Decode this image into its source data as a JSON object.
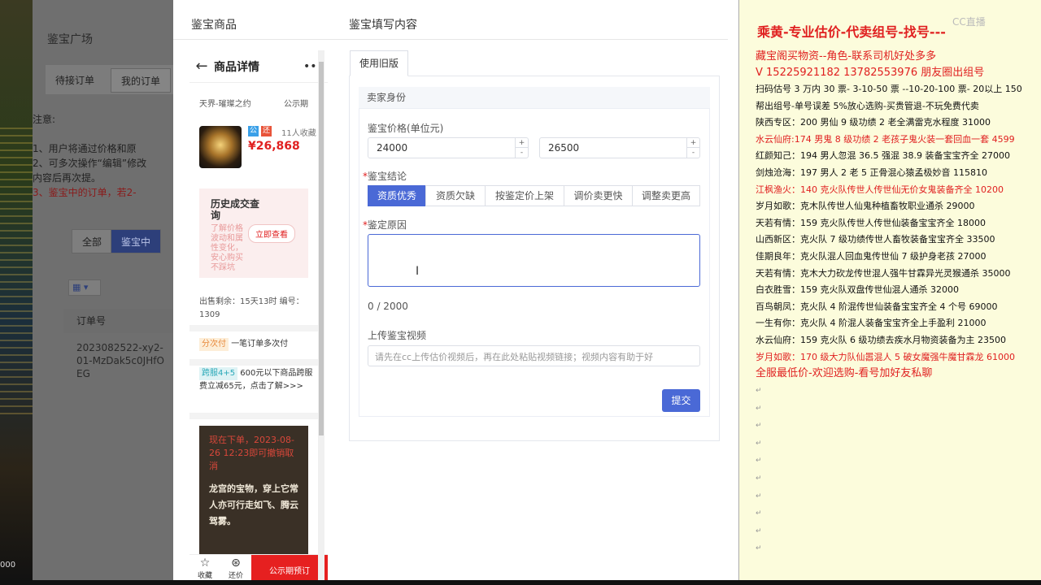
{
  "background": {
    "square_title": "鉴宝广场",
    "tabs": [
      "待接订单",
      "我的订单"
    ],
    "notice_title": "注意:",
    "notice_lines": [
      "1、用户将通过价格和原",
      "2、可多次操作“编辑”修改",
      "内容后再次提。",
      "3、鉴宝中的订单，若2-"
    ],
    "filters": [
      "全部",
      "鉴宝中"
    ],
    "order_header": "订单号",
    "order_value": "2023082522-xy2-01-MzDak5c0JHfOEG",
    "game_bottom": "000"
  },
  "modal": {
    "left_title": "鉴宝商品",
    "right_title": "鉴宝填写内容"
  },
  "phone": {
    "header_title": "商品详情",
    "server": "天界-璀璨之约",
    "period": "公示期",
    "badge1": "公",
    "badge2": "还",
    "favorites": "11人收藏",
    "price": "¥26,868",
    "history_title": "历史成交查询",
    "history_desc": "了解价格波动和属性变化，安心购买不踩坑",
    "history_btn": "立即查看",
    "stats": "出售剩余：15天13时  编号：1309",
    "installment_tag": "分次付",
    "installment_text": "一笔订单多次付",
    "cross_tag": "跨服4+5",
    "cross_text": "600元以下商品跨服费立减65元，点击了解>>>",
    "dark_red": "现在下单，2023-08-26 12:23即可撤销取消",
    "dark_white": "龙宫的宝物，穿上它常人亦可行走如飞、腾云驾雾。",
    "foot_fav": "收藏",
    "foot_bargain": "还价",
    "foot_buy": "公示期预订"
  },
  "form": {
    "tab_label": "使用旧版",
    "section_title": "卖家身份",
    "price_label": "鉴宝价格(单位元)",
    "price_min": "24000",
    "price_max": "26500",
    "conclusion_label": "鉴宝结论",
    "conclusion_options": [
      "资质优秀",
      "资质欠缺",
      "按鉴定价上架",
      "调价卖更快",
      "调整卖更高"
    ],
    "reason_label": "鉴定原因",
    "counter": "0 / 2000",
    "video_label": "上传鉴宝视频",
    "video_placeholder": "请先在cc上传估价视频后，再在此处粘贴视频链接；视频内容有助于好",
    "submit_label": "提交"
  },
  "notepad": {
    "title": "乘黄-专业估价-代卖组号-找号---",
    "watermark": "CC直播",
    "lines": [
      {
        "text": "藏宝阁买物资--角色-联系司机好处多多",
        "color": "red",
        "size": "big"
      },
      {
        "text": "V 15225921182   13782553976 朋友圈出组号",
        "color": "red",
        "size": "big"
      },
      {
        "text": "扫码估号 3 万内 30 票- 3-10-50 票  --10-20-100 票- 20以上 150",
        "color": "black"
      },
      {
        "text": "帮出组号-单号误差 5%放心选购-买贵管退-不玩免费代卖",
        "color": "black"
      },
      {
        "text": "陕西专区：200 男仙 9 级功绩 2 老全满雷克水程度 31000",
        "color": "black"
      },
      {
        "text": "水云仙府:174 男鬼 8 级功绩 2 老孩子鬼火装一套回血一套 4599",
        "color": "red"
      },
      {
        "text": "红颜知己：194 男人忽混 36.5 强混 38.9 装备宝宝齐全 27000",
        "color": "black"
      },
      {
        "text": "剑烛沧海：197 男人 2 老 5 正骨混心猿孟极妙音 115810",
        "color": "black"
      },
      {
        "text": "江枫渔火：140 克火队传世人传世仙无价女鬼装备齐全 10200",
        "color": "red"
      },
      {
        "text": "岁月如歌：克木队传世人仙鬼种植畜牧职业通杀 29000",
        "color": "black"
      },
      {
        "text": "天若有情：159 克火队传世人传世仙装备宝宝齐全 18000",
        "color": "black"
      },
      {
        "text": "山西新区：克火队 7 级功绩传世人畜牧装备宝宝齐全 33500",
        "color": "black"
      },
      {
        "text": "佳期良年：克火队混人回血鬼传世仙 7 级护身老孩 27000",
        "color": "black"
      },
      {
        "text": "天若有情：克木大力砍龙传世混人强牛甘霖异光灵猴通杀 35000",
        "color": "black"
      },
      {
        "text": "白衣胜雪：159 克火队双盘传世仙混人通杀 32000",
        "color": "black"
      },
      {
        "text": "百鸟朝凤：克火队 4 阶混传世仙装备宝宝齐全 4 个号 69000",
        "color": "black"
      },
      {
        "text": "一生有你：克火队 4 阶混人装备宝宝齐全上手盈利 21000",
        "color": "black"
      },
      {
        "text": "水云仙府：159 克火队 6 级功绩去疾水月物资装备为主 23500",
        "color": "black"
      },
      {
        "text": "岁月如歌：170 级大力队仙嚣混人 5 破女魔强牛魔甘霖龙 61000",
        "color": "red"
      },
      {
        "text": "全服最低价-欢迎选购-看号加好友私聊",
        "color": "red",
        "size": "big"
      }
    ]
  }
}
